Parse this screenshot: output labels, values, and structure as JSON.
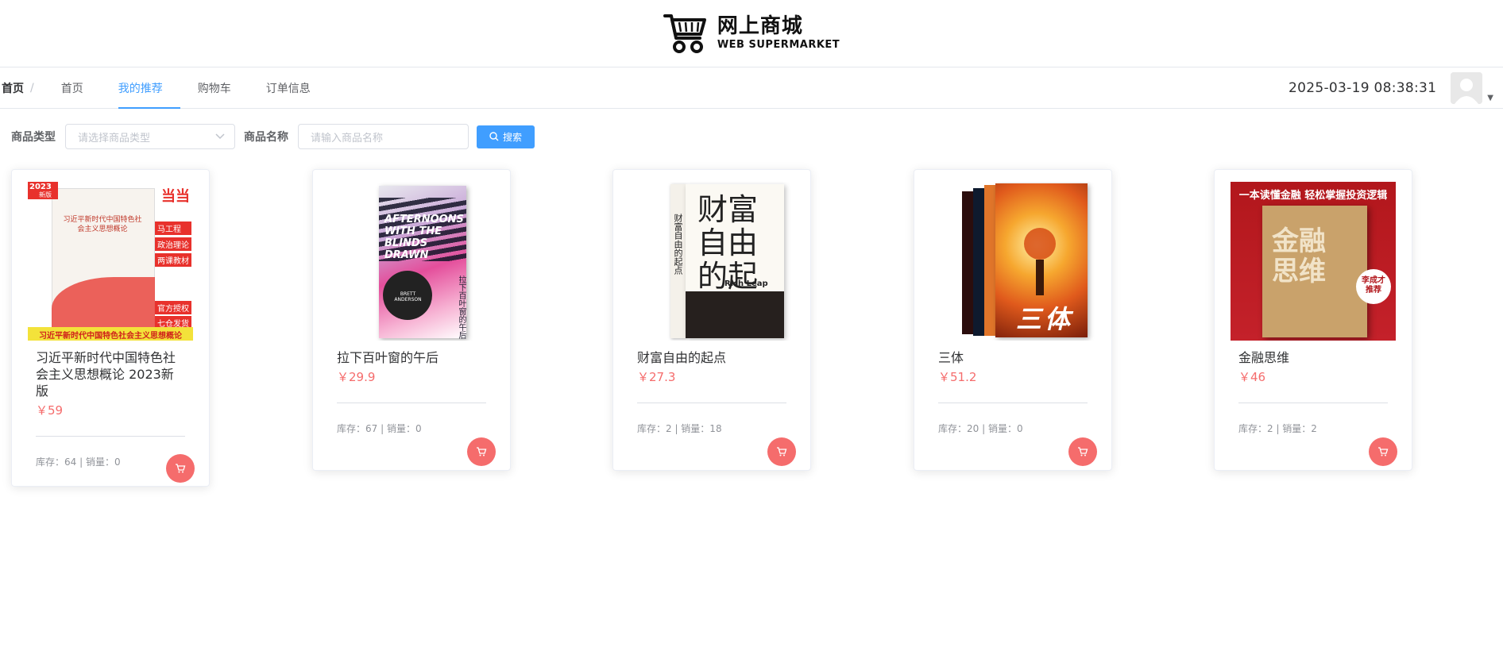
{
  "logo": {
    "title_cn": "网上商城",
    "title_en": "WEB SUPERMARKET"
  },
  "breadcrumb": {
    "home": "首页",
    "separator": "/"
  },
  "nav": {
    "items": [
      "首页",
      "我的推荐",
      "购物车",
      "订单信息"
    ],
    "active_index": 1
  },
  "clock": "2025-03-19 08:38:31",
  "search": {
    "type_label": "商品类型",
    "type_placeholder": "请选择商品类型",
    "name_label": "商品名称",
    "name_placeholder": "请输入商品名称",
    "button": "搜索"
  },
  "products": [
    {
      "title": "习近平新时代中国特色社会主义思想概论 2023新版",
      "price": "￥59",
      "stock_sales": "库存：64 | 销量：0",
      "cover": {
        "badge_year": "2023",
        "badge_new": "新版",
        "brand": "当当",
        "book_title": "习近平新时代中国特色社会主义思想概论",
        "tags": [
          "马工程",
          "政治理论",
          "两课教材"
        ],
        "tags2": [
          "官方授权",
          "七仓发货"
        ],
        "banner": "习近平新时代中国特色社会主义思想概论"
      }
    },
    {
      "title": "拉下百叶窗的午后",
      "price": "￥29.9",
      "stock_sales": "库存：67 | 销量：0",
      "cover": {
        "en_title": "AFTERNOONS WITH THE BLINDS DRAWN",
        "author": "BRETT ANDERSON",
        "cn_title": "拉下百叶窗的午后"
      }
    },
    {
      "title": "财富自由的起点",
      "price": "￥27.3",
      "stock_sales": "库存：2 | 销量：18",
      "cover": {
        "big_title": "财富自由的起点",
        "spine": "财富自由的起点",
        "en": "Rich Leap"
      }
    },
    {
      "title": "三体",
      "price": "￥51.2",
      "stock_sales": "库存：20 | 销量：0",
      "cover": {
        "title": "三体"
      }
    },
    {
      "title": "金融思维",
      "price": "￥46",
      "stock_sales": "库存：2 | 销量：2",
      "cover": {
        "headline": "一本读懂金融 轻松掌握投资逻辑",
        "big": "金融思维",
        "sticker": "李成才推荐"
      }
    }
  ],
  "colors": {
    "accent": "#409eff",
    "price": "#f56c6c",
    "cart": "#f56c6c"
  }
}
